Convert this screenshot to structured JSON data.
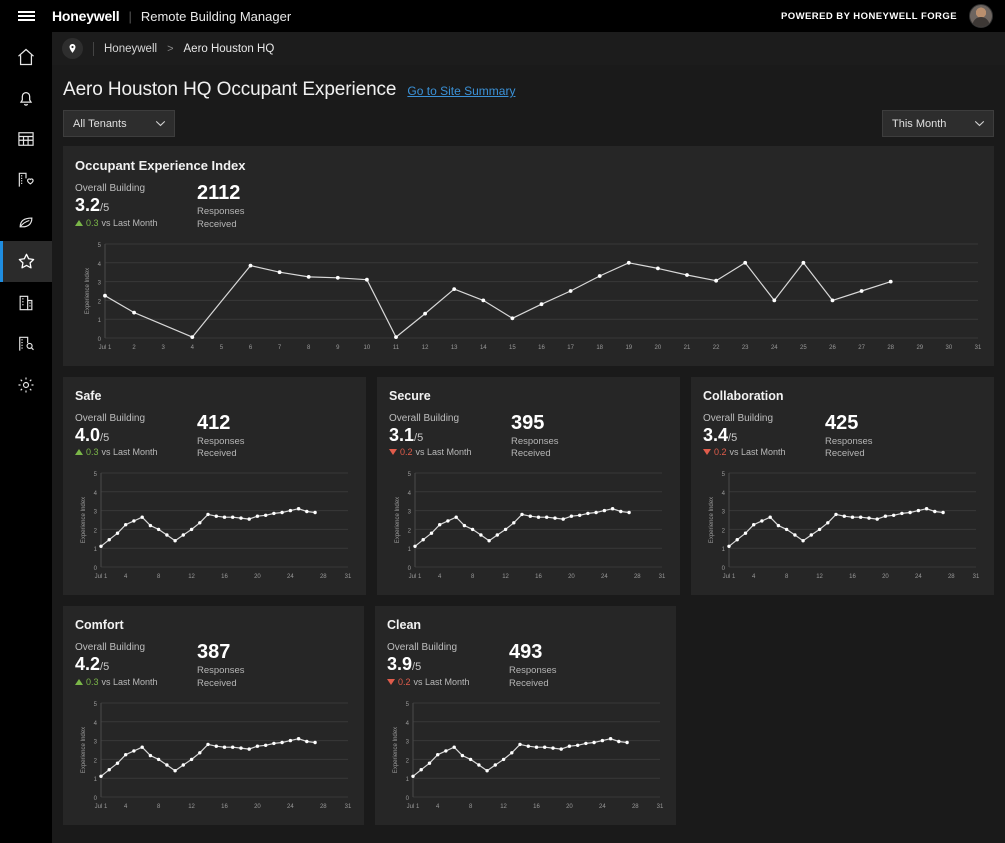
{
  "topbar": {
    "menu_icon": "hamburger-icon",
    "brand": "Honeywell",
    "brand_separator": "|",
    "product": "Remote Building Manager",
    "powered_by": "POWERED BY HONEYWELL FORGE",
    "avatar_icon": "user-avatar"
  },
  "sidebar": {
    "items": [
      {
        "name": "home",
        "icon": "home-icon",
        "active": false
      },
      {
        "name": "alerts",
        "icon": "bell-icon",
        "active": false
      },
      {
        "name": "schedule",
        "icon": "grid-calendar-icon",
        "active": false
      },
      {
        "name": "wellness",
        "icon": "building-heart-icon",
        "active": false
      },
      {
        "name": "energy",
        "icon": "leaf-icon",
        "active": false
      },
      {
        "name": "occupant-experience",
        "icon": "star-icon",
        "active": true
      },
      {
        "name": "buildings",
        "icon": "building-icon",
        "active": false
      },
      {
        "name": "building-search",
        "icon": "building-search-icon",
        "active": false
      },
      {
        "name": "settings",
        "icon": "gear-icon",
        "active": false
      }
    ]
  },
  "breadcrumb": {
    "pin_icon": "location-pin-icon",
    "root": "Honeywell",
    "separator": ">",
    "current": "Aero Houston HQ"
  },
  "page": {
    "title": "Aero Houston HQ Occupant Experience",
    "site_summary_link": "Go to Site Summary"
  },
  "filters": {
    "tenants": {
      "value": "All Tenants",
      "chevron_icon": "chevron-down-icon"
    },
    "period": {
      "value": "This Month",
      "chevron_icon": "chevron-down-icon"
    }
  },
  "labels": {
    "overall_building": "Overall Building",
    "denominator": "/5",
    "vs_last_month": "vs Last Month",
    "responses_line1": "Responses",
    "responses_line2": "Received"
  },
  "cards": [
    {
      "id": "occupant-experience-index",
      "title": "Occupant Experience Index",
      "score": "3.2",
      "delta": "0.3",
      "delta_direction": "up",
      "responses": "2112",
      "size": "large"
    },
    {
      "id": "safe",
      "title": "Safe",
      "score": "4.0",
      "delta": "0.3",
      "delta_direction": "up",
      "responses": "412",
      "size": "small"
    },
    {
      "id": "secure",
      "title": "Secure",
      "score": "3.1",
      "delta": "0.2",
      "delta_direction": "down",
      "responses": "395",
      "size": "small"
    },
    {
      "id": "collaboration",
      "title": "Collaboration",
      "score": "3.4",
      "delta": "0.2",
      "delta_direction": "down",
      "responses": "425",
      "size": "small"
    },
    {
      "id": "comfort",
      "title": "Comfort",
      "score": "4.2",
      "delta": "0.3",
      "delta_direction": "up",
      "responses": "387",
      "size": "small"
    },
    {
      "id": "clean",
      "title": "Clean",
      "score": "3.9",
      "delta": "0.2",
      "delta_direction": "down",
      "responses": "493",
      "size": "small"
    }
  ],
  "colors": {
    "page_bg": "#1a1a1a",
    "card_bg": "#262626",
    "topbar_bg": "#000000",
    "accent_link": "#3b92d8",
    "active_indicator": "#1f8de0",
    "up": "#7ab648",
    "down": "#e05c4b",
    "line": "#d8d8d8"
  },
  "chart_data": [
    {
      "id": "occupant-experience-index-chart",
      "type": "line",
      "title": "Occupant Experience Index",
      "xlabel": "",
      "ylabel": "Experience Index",
      "ylim": [
        0,
        5
      ],
      "yticks": [
        0,
        1,
        2,
        3,
        4,
        5
      ],
      "grid": true,
      "legend": "none",
      "x": [
        1,
        2,
        3,
        4,
        5,
        6,
        7,
        8,
        9,
        10,
        11,
        12,
        13,
        14,
        15,
        16,
        17,
        18,
        19,
        20,
        21,
        22,
        23,
        24,
        25,
        26,
        27,
        28,
        29,
        30,
        31
      ],
      "xticklabels": [
        "Jul 1",
        "2",
        "3",
        "4",
        "5",
        "6",
        "7",
        "8",
        "9",
        "10",
        "11",
        "12",
        "13",
        "14",
        "15",
        "16",
        "17",
        "18",
        "19",
        "20",
        "21",
        "22",
        "23",
        "24",
        "25",
        "26",
        "27",
        "28",
        "29",
        "30",
        "31"
      ],
      "values": [
        2.25,
        1.35,
        null,
        0.05,
        1.95,
        3.85,
        3.5,
        3.25,
        3.2,
        3.1,
        0.05,
        1.3,
        2.6,
        2.0,
        1.05,
        1.8,
        2.5,
        3.3,
        4.0,
        3.7,
        3.35,
        3.05,
        4.0,
        2.0,
        4.0,
        2.0,
        2.5,
        3.0,
        null,
        null,
        null
      ],
      "markers_at": [
        1,
        2,
        4,
        6,
        7,
        8,
        9,
        10,
        11,
        12,
        13,
        14,
        15,
        16,
        17,
        18,
        19,
        20,
        21,
        22,
        23,
        24,
        25,
        26,
        27,
        28
      ]
    },
    {
      "id": "safe-chart",
      "type": "line",
      "title": "Safe",
      "xlabel": "",
      "ylabel": "Experience Index",
      "ylim": [
        0,
        5
      ],
      "yticks": [
        0,
        1,
        2,
        3,
        4,
        5
      ],
      "grid": true,
      "legend": "none",
      "x": [
        1,
        2,
        3,
        4,
        5,
        6,
        7,
        8,
        9,
        10,
        11,
        12,
        13,
        14,
        15,
        16,
        17,
        18,
        19,
        20,
        21,
        22,
        23,
        24,
        25,
        26,
        27
      ],
      "xticklabels": [
        "Jul 1",
        "4",
        "8",
        "12",
        "16",
        "20",
        "24",
        "28",
        "31"
      ],
      "xtickvalues": [
        1,
        4,
        8,
        12,
        16,
        20,
        24,
        28,
        31
      ],
      "values": [
        1.1,
        1.45,
        1.8,
        2.25,
        2.45,
        2.65,
        2.2,
        2.0,
        1.7,
        1.4,
        1.7,
        2.0,
        2.35,
        2.8,
        2.7,
        2.65,
        2.65,
        2.6,
        2.55,
        2.7,
        2.75,
        2.85,
        2.9,
        3.0,
        3.1,
        2.95,
        2.9
      ]
    },
    {
      "id": "secure-chart",
      "type": "line",
      "title": "Secure",
      "xlabel": "",
      "ylabel": "Experience Index",
      "ylim": [
        0,
        5
      ],
      "yticks": [
        0,
        1,
        2,
        3,
        4,
        5
      ],
      "grid": true,
      "legend": "none",
      "x": [
        1,
        2,
        3,
        4,
        5,
        6,
        7,
        8,
        9,
        10,
        11,
        12,
        13,
        14,
        15,
        16,
        17,
        18,
        19,
        20,
        21,
        22,
        23,
        24,
        25,
        26,
        27
      ],
      "xticklabels": [
        "Jul 1",
        "4",
        "8",
        "12",
        "16",
        "20",
        "24",
        "28",
        "31"
      ],
      "xtickvalues": [
        1,
        4,
        8,
        12,
        16,
        20,
        24,
        28,
        31
      ],
      "values": [
        1.1,
        1.45,
        1.8,
        2.25,
        2.45,
        2.65,
        2.2,
        2.0,
        1.7,
        1.4,
        1.7,
        2.0,
        2.35,
        2.8,
        2.7,
        2.65,
        2.65,
        2.6,
        2.55,
        2.7,
        2.75,
        2.85,
        2.9,
        3.0,
        3.1,
        2.95,
        2.9
      ]
    },
    {
      "id": "collaboration-chart",
      "type": "line",
      "title": "Collaboration",
      "xlabel": "",
      "ylabel": "Experience Index",
      "ylim": [
        0,
        5
      ],
      "yticks": [
        0,
        1,
        2,
        3,
        4,
        5
      ],
      "grid": true,
      "legend": "none",
      "x": [
        1,
        2,
        3,
        4,
        5,
        6,
        7,
        8,
        9,
        10,
        11,
        12,
        13,
        14,
        15,
        16,
        17,
        18,
        19,
        20,
        21,
        22,
        23,
        24,
        25,
        26,
        27
      ],
      "xticklabels": [
        "Jul 1",
        "4",
        "8",
        "12",
        "16",
        "20",
        "24",
        "28",
        "31"
      ],
      "xtickvalues": [
        1,
        4,
        8,
        12,
        16,
        20,
        24,
        28,
        31
      ],
      "values": [
        1.1,
        1.45,
        1.8,
        2.25,
        2.45,
        2.65,
        2.2,
        2.0,
        1.7,
        1.4,
        1.7,
        2.0,
        2.35,
        2.8,
        2.7,
        2.65,
        2.65,
        2.6,
        2.55,
        2.7,
        2.75,
        2.85,
        2.9,
        3.0,
        3.1,
        2.95,
        2.9
      ]
    },
    {
      "id": "comfort-chart",
      "type": "line",
      "title": "Comfort",
      "xlabel": "",
      "ylabel": "Experience Index",
      "ylim": [
        0,
        5
      ],
      "yticks": [
        0,
        1,
        2,
        3,
        4,
        5
      ],
      "grid": true,
      "legend": "none",
      "x": [
        1,
        2,
        3,
        4,
        5,
        6,
        7,
        8,
        9,
        10,
        11,
        12,
        13,
        14,
        15,
        16,
        17,
        18,
        19,
        20,
        21,
        22,
        23,
        24,
        25,
        26,
        27
      ],
      "xticklabels": [
        "Jul 1",
        "4",
        "8",
        "12",
        "16",
        "20",
        "24",
        "28",
        "31"
      ],
      "xtickvalues": [
        1,
        4,
        8,
        12,
        16,
        20,
        24,
        28,
        31
      ],
      "values": [
        1.1,
        1.45,
        1.8,
        2.25,
        2.45,
        2.65,
        2.2,
        2.0,
        1.7,
        1.4,
        1.7,
        2.0,
        2.35,
        2.8,
        2.7,
        2.65,
        2.65,
        2.6,
        2.55,
        2.7,
        2.75,
        2.85,
        2.9,
        3.0,
        3.1,
        2.95,
        2.9
      ]
    },
    {
      "id": "clean-chart",
      "type": "line",
      "title": "Clean",
      "xlabel": "",
      "ylabel": "Experience Index",
      "ylim": [
        0,
        5
      ],
      "yticks": [
        0,
        1,
        2,
        3,
        4,
        5
      ],
      "grid": true,
      "legend": "none",
      "x": [
        1,
        2,
        3,
        4,
        5,
        6,
        7,
        8,
        9,
        10,
        11,
        12,
        13,
        14,
        15,
        16,
        17,
        18,
        19,
        20,
        21,
        22,
        23,
        24,
        25,
        26,
        27
      ],
      "xticklabels": [
        "Jul 1",
        "4",
        "8",
        "12",
        "16",
        "20",
        "24",
        "28",
        "31"
      ],
      "xtickvalues": [
        1,
        4,
        8,
        12,
        16,
        20,
        24,
        28,
        31
      ],
      "values": [
        1.1,
        1.45,
        1.8,
        2.25,
        2.45,
        2.65,
        2.2,
        2.0,
        1.7,
        1.4,
        1.7,
        2.0,
        2.35,
        2.8,
        2.7,
        2.65,
        2.65,
        2.6,
        2.55,
        2.7,
        2.75,
        2.85,
        2.9,
        3.0,
        3.1,
        2.95,
        2.9
      ]
    }
  ]
}
